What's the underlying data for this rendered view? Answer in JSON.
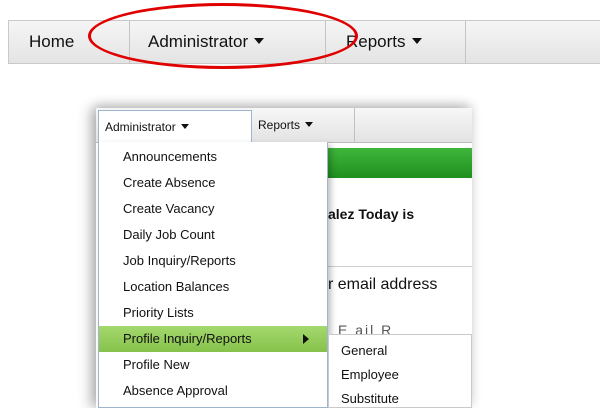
{
  "nav": {
    "home": "Home",
    "administrator": "Administrator",
    "reports": "Reports"
  },
  "inset": {
    "bar": {
      "administrator": "Administrator",
      "reports": "Reports"
    },
    "background": {
      "line1": "alez  Today is",
      "line2": "r email address",
      "line3": "E  ail    R"
    },
    "menu": [
      "Announcements",
      "Create Absence",
      "Create Vacancy",
      "Daily Job Count",
      "Job Inquiry/Reports",
      "Location Balances",
      "Priority Lists",
      "Profile Inquiry/Reports",
      "Profile New",
      "Absence Approval"
    ],
    "highlighted_item": "Profile Inquiry/Reports",
    "submenu": [
      "General",
      "Employee",
      "Substitute"
    ]
  },
  "colors": {
    "annotation_ellipse": "#e00000",
    "highlight": "#97cf5c",
    "banner_green": "#2aa02a"
  }
}
